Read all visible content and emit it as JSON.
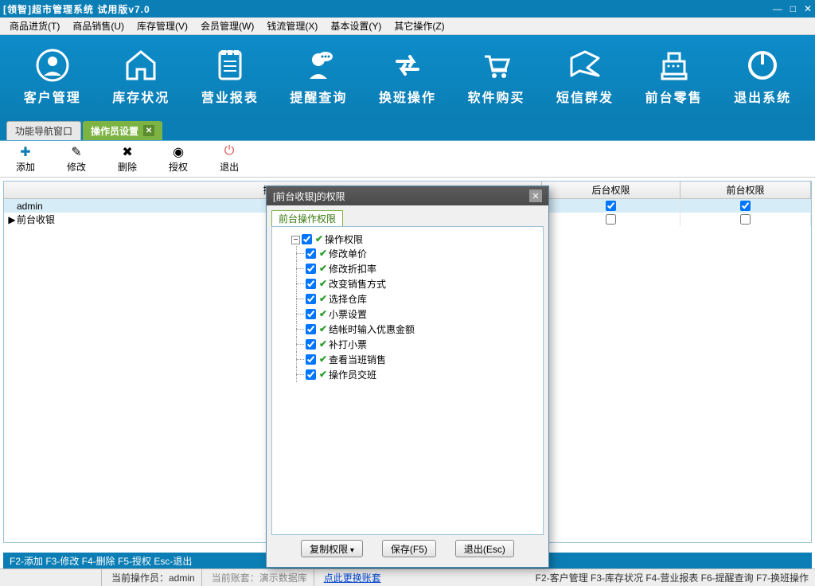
{
  "title": "[领智]超市管理系统 试用版v7.0",
  "menus": [
    "商品进货(T)",
    "商品销售(U)",
    "库存管理(V)",
    "会员管理(W)",
    "钱流管理(X)",
    "基本设置(Y)",
    "其它操作(Z)"
  ],
  "mainTools": [
    {
      "name": "customer",
      "label": "客户管理"
    },
    {
      "name": "inventory",
      "label": "库存状况"
    },
    {
      "name": "report",
      "label": "营业报表"
    },
    {
      "name": "remind",
      "label": "提醒查询"
    },
    {
      "name": "shift",
      "label": "换班操作"
    },
    {
      "name": "buy",
      "label": "软件购买"
    },
    {
      "name": "sms",
      "label": "短信群发"
    },
    {
      "name": "pos",
      "label": "前台零售"
    },
    {
      "name": "exit",
      "label": "退出系统"
    }
  ],
  "tabs": {
    "inactive": "功能导航窗口",
    "active": "操作员设置"
  },
  "subTools": [
    {
      "name": "add",
      "label": "添加",
      "icon": "✚",
      "cls": "add"
    },
    {
      "name": "edit",
      "label": "修改",
      "icon": "✎",
      "cls": ""
    },
    {
      "name": "delete",
      "label": "删除",
      "icon": "✖",
      "cls": ""
    },
    {
      "name": "auth",
      "label": "授权",
      "icon": "◉",
      "cls": ""
    },
    {
      "name": "exit",
      "label": "退出",
      "icon": "⏻",
      "cls": "exit"
    }
  ],
  "gridHeaders": {
    "operator": "操作",
    "back": "后台权限",
    "front": "前台权限"
  },
  "gridRows": [
    {
      "name": "admin",
      "back": true,
      "front": true,
      "selected": true,
      "marker": ""
    },
    {
      "name": "前台收银",
      "back": false,
      "front": false,
      "selected": false,
      "marker": "▶"
    }
  ],
  "dialog": {
    "title": "[前台收银]的权限",
    "tab": "前台操作权限",
    "rootLabel": "操作权限",
    "nodes": [
      "修改单价",
      "修改折扣率",
      "改变销售方式",
      "选择仓库",
      "小票设置",
      "结帐时输入优惠金额",
      "补打小票",
      "查看当班销售",
      "操作员交班"
    ],
    "btnCopy": "复制权限",
    "btnSave": "保存(F5)",
    "btnExit": "退出(Esc)"
  },
  "footerShortcuts": "F2-添加 F3-修改 F4-删除 F5-授权 Esc-退出",
  "status": {
    "operator": "当前操作员：admin",
    "account": "当前账套：演示数据库",
    "link": "点此更换账套",
    "shortcuts": "F2-客户管理 F3-库存状况 F4-营业报表 F6-提醒查询 F7-换班操作"
  }
}
